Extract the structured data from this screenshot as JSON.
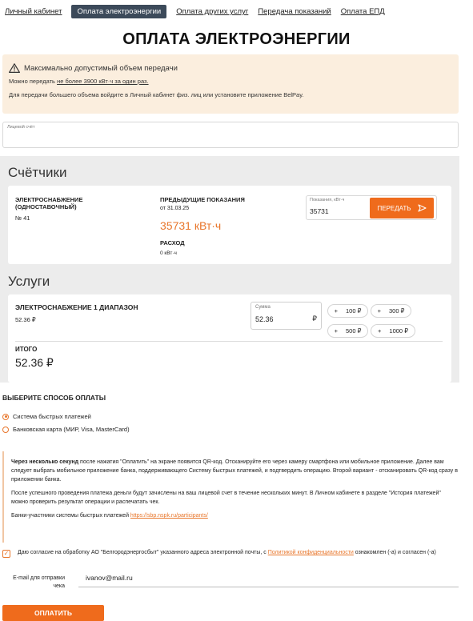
{
  "nav": {
    "items": [
      {
        "label": "Личный кабинет",
        "active": false
      },
      {
        "label": "Оплата электроэнергии",
        "active": true
      },
      {
        "label": "Оплата других услуг",
        "active": false
      },
      {
        "label": "Передача показаний",
        "active": false
      },
      {
        "label": "Оплата ЕПД",
        "active": false
      }
    ]
  },
  "page_title": "ОПЛАТА ЭЛЕКТРОЭНЕРГИИ",
  "warning": {
    "icon": "warning-triangle-icon",
    "title": "Максимально допустимый объем передачи",
    "line1_prefix": "Можно передать ",
    "line1_link": "не более 3900 кВт·ч за один раз.",
    "line2": "Для передачи большего объема войдите в Личный кабинет физ. лиц или установите приложение BelPay."
  },
  "account_field": {
    "label": "Лицевой счёт",
    "value": ""
  },
  "counters": {
    "title": "Счётчики",
    "name": "ЭЛЕКТРОСНАБЖЕНИЕ (ОДНОСТАВОЧНЫЙ)",
    "number": "№ 41",
    "prev_label": "ПРЕДЫДУЩИЕ ПОКАЗАНИЯ",
    "prev_date": "от 31.03.25",
    "prev_value": "35731 кВт·ч",
    "expense_label": "РАСХОД",
    "expense_value": "0 кВт·ч",
    "reading_label": "Показания, кВт·ч",
    "reading_value": "35731",
    "send_label": "ПЕРЕДАТЬ"
  },
  "services": {
    "title": "Услуги",
    "name": "ЭЛЕКТРОСНАБЖЕНИЕ 1 ДИАПАЗОН",
    "amount": "52.36 ₽",
    "sum_label": "Сумма",
    "sum_value": "52.36",
    "sum_currency": "₽",
    "quick_add": [
      {
        "plus": "+",
        "label": "100 ₽"
      },
      {
        "plus": "+",
        "label": "300 ₽"
      },
      {
        "plus": "+",
        "label": "500 ₽"
      },
      {
        "plus": "+",
        "label": "1000 ₽"
      }
    ],
    "total_label": "ИТОГО",
    "total_value": "52.36 ₽"
  },
  "payment": {
    "title": "ВЫБЕРИТЕ СПОСОБ ОПЛАТЫ",
    "options": [
      {
        "label": "Система быстрых платежей",
        "selected": true
      },
      {
        "label": "Банковская карта (МИР, Visa, MasterCard)",
        "selected": false
      }
    ],
    "info_bold": "Через несколько секунд",
    "info_p1": " после нажатия \"Оплатить\" на экране появится QR-код. Отсканируйте его через камеру смартфона или мобильное приложение. Далее вам следует выбрать мобильное приложение банка, поддерживающего Систему быстрых платежей, и подтвердить операцию. Второй вариант - отсканировать QR-код сразу в приложении банка.",
    "info_p2": "После успешного проведения платежа деньги будут зачислены на ваш лицевой счет в течение нескольких минут. В Личном кабинете в разделе \"История платежей\" можно проверить результат операции и распечатать чек.",
    "info_p3_prefix": "Банки-участники системы быстрых платежей ",
    "info_p3_link": "https://sbp.nspk.ru/participants/"
  },
  "consent": {
    "checked": true,
    "text_prefix": "Даю согласие на обработку АО \"Белгородэнергосбыт\" указанного адреса электронной почты, с ",
    "link": "Политикой конфиденциальности",
    "text_suffix": " ознакомлен (-а) и согласен (-а)"
  },
  "email": {
    "label": "E-mail для отправки чека",
    "value": "ivanov@mail.ru"
  },
  "pay_button": "ОПЛАТИТЬ",
  "colors": {
    "accent": "#ef6b1c",
    "nav_active": "#3c4a5a",
    "warning_bg": "#fbeede"
  }
}
